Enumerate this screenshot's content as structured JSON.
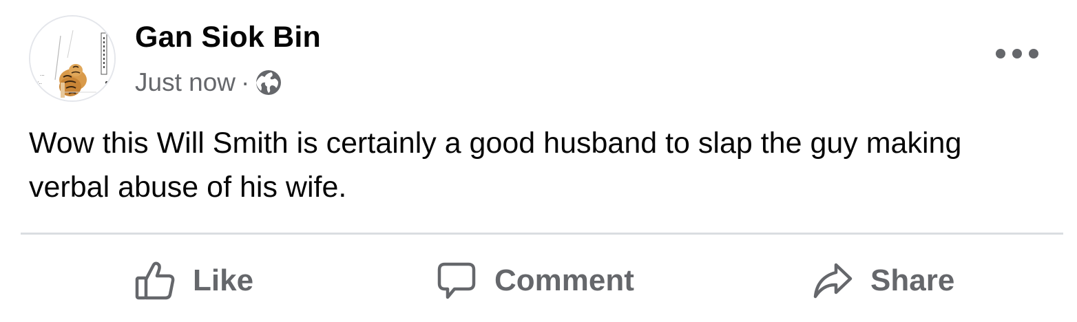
{
  "post": {
    "author": "Gan Siok Bin",
    "timestamp": "Just now",
    "separator": "·",
    "audience_icon": "globe-icon",
    "text": "Wow this Will Smith is certainly a good husband to slap the guy making verbal abuse of his wife."
  },
  "actions": {
    "like_label": "Like",
    "comment_label": "Comment",
    "share_label": "Share"
  },
  "colors": {
    "primary_text": "#050505",
    "secondary_text": "#65676b",
    "divider": "#dadde1"
  }
}
